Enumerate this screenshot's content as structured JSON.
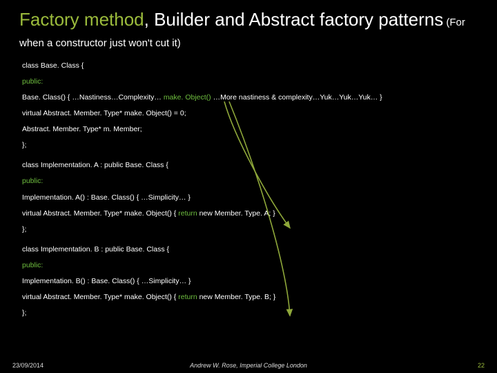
{
  "title": {
    "accent": "Factory method",
    "rest": ", Builder and Abstract factory patterns",
    "subtitle": " (For when a constructor just won't cut it)"
  },
  "code": {
    "base": {
      "decl": "class Base. Class {",
      "public": "public:",
      "ctor_pre": " Base. Class() { …Nastiness…Complexity… ",
      "ctor_make": "make. Object()",
      "ctor_post": " …More nastiness & complexity…Yuk…Yuk…Yuk… }",
      "virt": " virtual Abstract. Member. Type* make. Object() = 0;",
      "member": " Abstract. Member. Type* m. Member;",
      "close": "};"
    },
    "implA": {
      "decl": "class Implementation. A : public Base. Class {",
      "public": "public:",
      "ctor": " Implementation. A() : Base. Class() { …Simplicity… }",
      "virt_pre": " virtual Abstract. Member. Type* make. Object() { ",
      "virt_ret": "return",
      "virt_post": " new Member. Type. A; }",
      "close": "};"
    },
    "implB": {
      "decl": "class Implementation. B : public Base. Class {",
      "public": "public:",
      "ctor": " Implementation. B() : Base. Class() { …Simplicity… }",
      "virt_pre": " virtual Abstract. Member. Type* make. Object() { ",
      "virt_ret": "return",
      "virt_post": " new Member. Type. B; }",
      "close": "};"
    }
  },
  "footer": {
    "date": "23/09/2014",
    "center": "Andrew W. Rose, Imperial College London",
    "page": "22"
  }
}
